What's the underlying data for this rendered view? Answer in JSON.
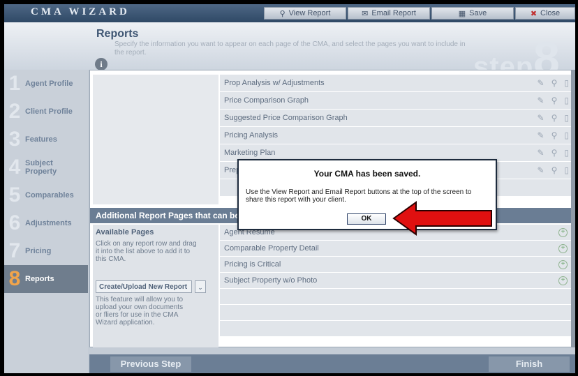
{
  "app": {
    "logo_text": "CMA WIZARD"
  },
  "toolbar": {
    "view_report": "View Report",
    "email_report": "Email Report",
    "save": "Save",
    "close": "Close"
  },
  "header": {
    "title": "Reports",
    "instructions": "Specify the information you want to appear on each page of the CMA, and select the pages you want to include in the report.",
    "step_word": "step",
    "step_number": "8",
    "info_glyph": "i"
  },
  "sidebar": {
    "items": [
      {
        "num": "1",
        "label": "Agent Profile"
      },
      {
        "num": "2",
        "label": "Client Profile"
      },
      {
        "num": "3",
        "label": "Features"
      },
      {
        "num": "4",
        "label": "Subject Property"
      },
      {
        "num": "5",
        "label": "Comparables"
      },
      {
        "num": "6",
        "label": "Adjustments"
      },
      {
        "num": "7",
        "label": "Pricing"
      },
      {
        "num": "8",
        "label": "Reports"
      }
    ],
    "active_index": 7
  },
  "report_pages": [
    "Prop Analysis w/ Adjustments",
    "Price Comparison Graph",
    "Suggested Price Comparison Graph",
    "Pricing Analysis",
    "Marketing Plan",
    "Preparing Your Home"
  ],
  "additional": {
    "bar_text": "Additional Report Pages that can be added to the Current CMA",
    "available_title": "Available Pages",
    "available_desc": "Click on any report row and drag it into the list above to add it to this CMA.",
    "create_button": "Create/Upload New Report",
    "feature_desc": "This feature will allow you to upload your own documents or fliers for use in the CMA Wizard application.",
    "pages": [
      "Agent Resume",
      "Comparable Property Detail",
      "Pricing is Critical",
      "Subject Property w/o Photo"
    ]
  },
  "footer": {
    "previous": "Previous Step",
    "finish": "Finish"
  },
  "dialog": {
    "title": "Your CMA has been saved.",
    "message": "Use the View Report and Email Report buttons at the top of the screen to share this report with your client.",
    "ok": "OK"
  },
  "colors": {
    "arrow": "#e01010",
    "active_step_number": "#f2a44a",
    "header_bar": "#2f4966"
  }
}
